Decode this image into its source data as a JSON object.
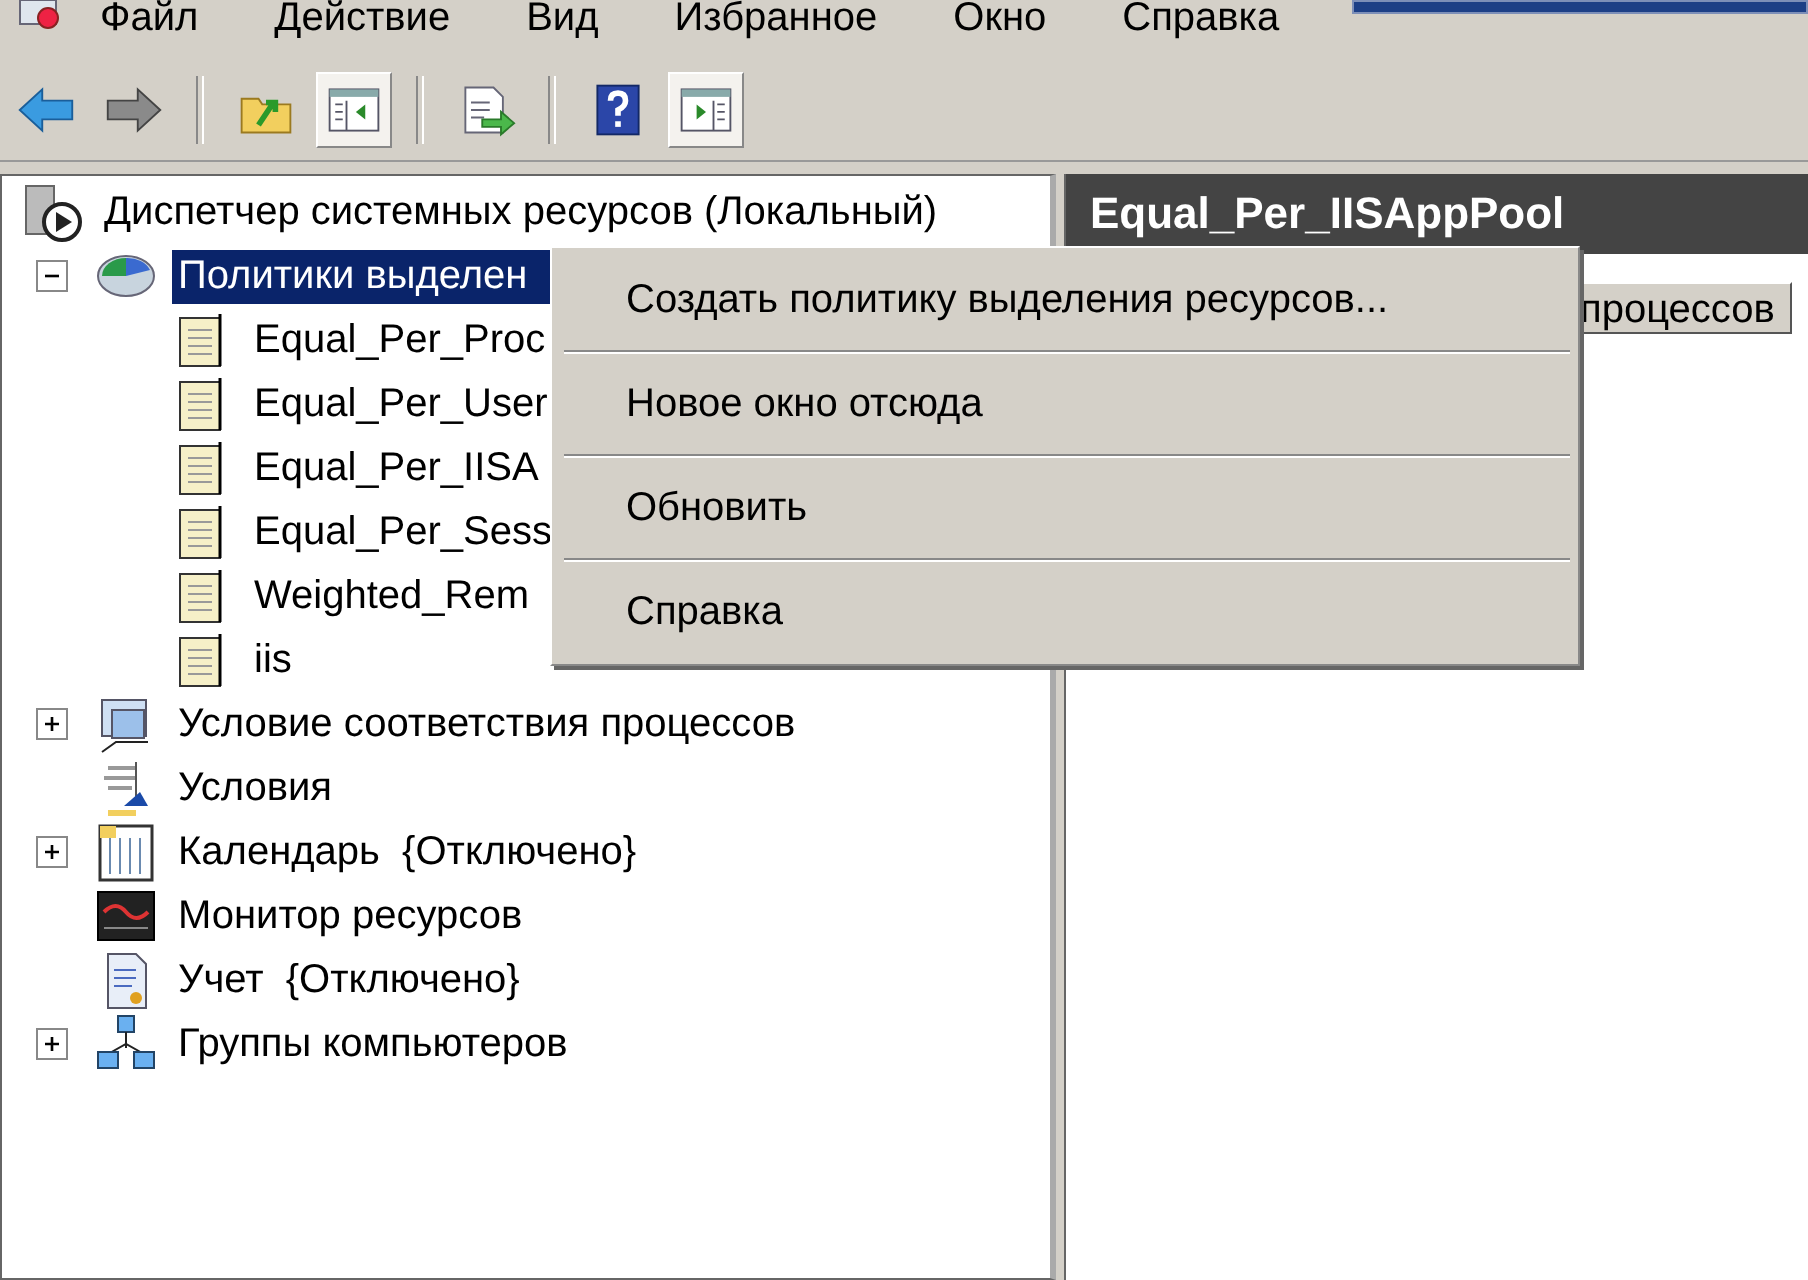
{
  "menu_bar": [
    "Файл",
    "Действие",
    "Вид",
    "Избранное",
    "Окно",
    "Справка"
  ],
  "toolbar": [
    {
      "kind": "back",
      "pressed": false
    },
    {
      "kind": "forward",
      "pressed": false
    },
    {
      "kind": "separator"
    },
    {
      "kind": "up",
      "pressed": false
    },
    {
      "kind": "tree-pane",
      "pressed": true
    },
    {
      "kind": "separator"
    },
    {
      "kind": "export",
      "pressed": false
    },
    {
      "kind": "separator"
    },
    {
      "kind": "help",
      "pressed": false
    },
    {
      "kind": "action-pane",
      "pressed": true
    }
  ],
  "tree": {
    "label": "Диспетчер системных ресурсов (Локальный)",
    "kind": "root",
    "selected": false,
    "children": [
      {
        "label": "Политики выделен",
        "kind": "policies",
        "expanded": true,
        "selected": true,
        "children": [
          {
            "label": "Equal_Per_Proc",
            "kind": "policy",
            "selected": false
          },
          {
            "label": "Equal_Per_User",
            "kind": "policy",
            "selected": false
          },
          {
            "label": "Equal_Per_IISA",
            "kind": "policy",
            "selected": false
          },
          {
            "label": "Equal_Per_Sess",
            "kind": "policy",
            "selected": false
          },
          {
            "label": "Weighted_Rem",
            "kind": "policy",
            "selected": false
          },
          {
            "label": "iis",
            "kind": "policy",
            "selected": false
          }
        ]
      },
      {
        "label": "Условие соответствия процессов",
        "kind": "process-match",
        "expanded": false,
        "selected": false
      },
      {
        "label": "Условия",
        "kind": "conditions",
        "selected": false
      },
      {
        "label": "Календарь  {Отключено}",
        "kind": "calendar",
        "expanded": false,
        "selected": false
      },
      {
        "label": "Монитор ресурсов",
        "kind": "monitor",
        "selected": false
      },
      {
        "label": "Учет  {Отключено}",
        "kind": "accounting",
        "selected": false
      },
      {
        "label": "Группы компьютеров",
        "kind": "computer-groups",
        "expanded": false,
        "selected": false
      }
    ]
  },
  "details": {
    "title": "Equal_Per_IISAppPool",
    "columns": [
      "процессов"
    ]
  },
  "context_menu": [
    "Создать политику выделения ресурсов...",
    "Новое окно отсюда",
    "Обновить",
    "Справка"
  ]
}
